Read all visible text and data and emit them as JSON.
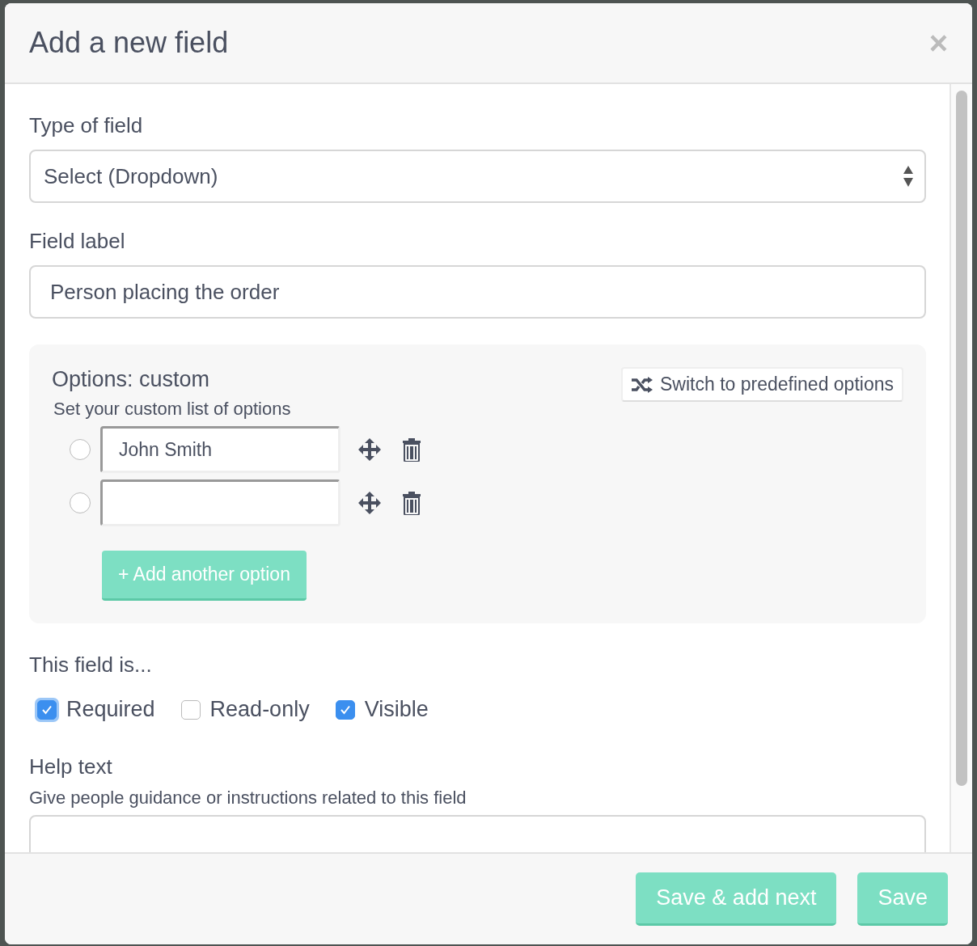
{
  "dialog": {
    "title": "Add a new field",
    "close": "×"
  },
  "type_of_field": {
    "label": "Type of field",
    "value": "Select (Dropdown)"
  },
  "field_label": {
    "label": "Field label",
    "value": "Person placing the order"
  },
  "options": {
    "title": "Options: custom",
    "hint": "Set your custom list of options",
    "switch_button": "Switch to predefined options",
    "add_button": "+ Add another option",
    "items": [
      {
        "value": "John Smith",
        "selected": false
      },
      {
        "selected": false
      }
    ]
  },
  "field_is": {
    "label": "This field is...",
    "checkboxes": [
      {
        "label": "Required",
        "checked": true,
        "focused": true
      },
      {
        "label": "Read-only",
        "checked": false,
        "focused": false
      },
      {
        "label": "Visible",
        "checked": true,
        "focused": false
      }
    ]
  },
  "help_text": {
    "label": "Help text",
    "hint": "Give people guidance or instructions related to this field"
  },
  "footer": {
    "buttons": [
      "Save & add next",
      "Save"
    ]
  }
}
